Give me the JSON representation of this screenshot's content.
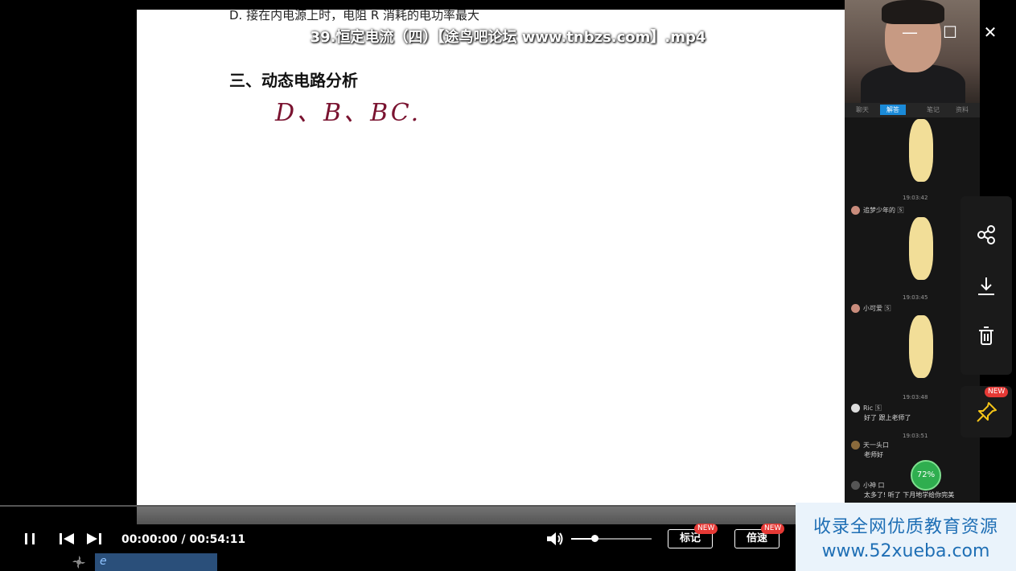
{
  "video": {
    "title": "39.恒定电流（四）【途鸟吧论坛 www.tnbzs.com】.mp4"
  },
  "slide": {
    "option_line": "D. 接在内电源上时，电阻 R 消耗的电功率最大",
    "section_title": "三、动态电路分析",
    "handwriting": "D、B、BC."
  },
  "window_controls": {
    "minimize": "—",
    "maximize": "☐",
    "close": "✕"
  },
  "chat": {
    "tabs": [
      "聊天",
      "解答",
      "笔记",
      "资料"
    ],
    "timestamps": [
      "19:03:42",
      "19:03:45",
      "19:03:48",
      "19:03:51"
    ],
    "messages": [
      {
        "user": "追梦少年的 🅂",
        "text": ""
      },
      {
        "user": "小可爱 🅂",
        "text": ""
      },
      {
        "user": "Ric 🅂",
        "text": "好了 跟上老师了"
      },
      {
        "user": "天一头口",
        "text": "老师好"
      },
      {
        "user": "小神 口",
        "text": "太多了! 听了  下月地学给你完美"
      }
    ],
    "battery_percent": "72%"
  },
  "side_panel": {
    "icons": [
      "share-icon",
      "download-icon",
      "trash-icon",
      "pin-icon"
    ],
    "pin_badge": "NEW"
  },
  "controls": {
    "current_time": "00:00:00",
    "separator": "/",
    "total_time": "00:54:11",
    "progress_fraction": 0.0,
    "volume_fraction": 0.29,
    "mark_label": "标记",
    "mark_badge": "NEW",
    "speed_label": "倍速",
    "speed_badge": "NEW"
  },
  "watermark": {
    "line1": "收录全网优质教育资源",
    "line2": "www.52xueba.com"
  },
  "colors": {
    "handwriting": "#7a1330",
    "watermark_text": "#1f6fb5",
    "badge": "#e53935"
  }
}
